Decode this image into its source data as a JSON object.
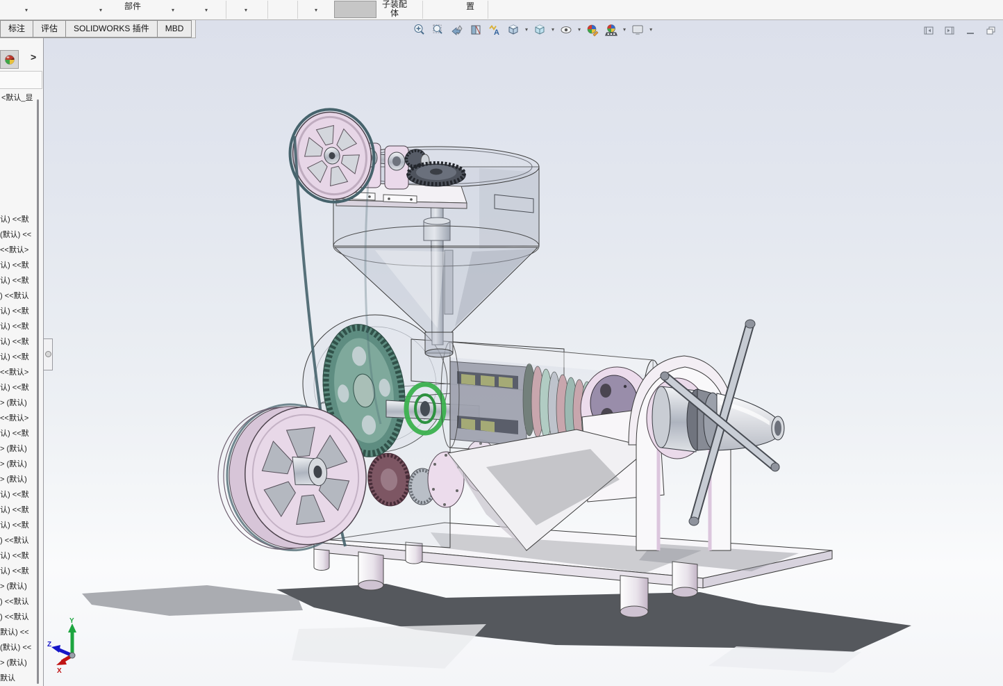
{
  "command_manager": {
    "part_label": "部件",
    "subassembly_label": "子装配体",
    "layout_label": "置",
    "dropdown_glyph": "▾",
    "tabs": [
      "标注",
      "评估",
      "SOLIDWORKS 插件",
      "MBD"
    ]
  },
  "view_toolbar": {
    "dropdown_glyph": "▾",
    "icons": [
      "zoom-to-fit",
      "zoom-to-area",
      "previous-view",
      "section-view",
      "hide-show-annotations",
      "view-orientation",
      "display-style",
      "hide-show-items",
      "edit-appearance",
      "apply-scene",
      "view-settings"
    ]
  },
  "window_controls": {
    "icons": [
      "collapse-left-pane",
      "collapse-right-pane",
      "minimize-window",
      "restore-window"
    ]
  },
  "sidebar": {
    "panel_tab_icon": "appearance-sphere-icon",
    "expand_glyph": ">",
    "config_header": "<默认_显",
    "items": [
      "认) <<默",
      "(默认) <<",
      "<<默认>",
      "认) <<默",
      "认) <<默",
      ") <<默认",
      "认) <<默",
      "认) <<默",
      "认) <<默",
      "认) <<默",
      "<<默认>",
      "认) <<默",
      "> (默认)",
      "<<默认>",
      "认) <<默",
      "> (默认)",
      "> (默认)",
      "> (默认)",
      "认) <<默",
      "认) <<默",
      "认) <<默",
      ") <<默认",
      "认) <<默",
      "认) <<默",
      "> (默认)",
      ") <<默认",
      ") <<默认",
      "默认) <<",
      "(默认) <<",
      "> (默认)",
      "默认"
    ]
  },
  "viewport": {
    "triad": {
      "x": "X",
      "y": "Y",
      "z": "Z"
    },
    "model": "screw-oil-press-assembly",
    "palette": {
      "background_top": "#dce0eb",
      "background_bottom": "#fafbfc",
      "machine_pink": "#e7d7e7",
      "gear_teal": "#5e8d81",
      "bearing_green": "#3bb14e",
      "ring_pink": "#c59ba2",
      "ring_teal": "#a9cabc",
      "belt": "#46636c",
      "floor_shadow": "#55585d",
      "white_parts": "#f8f6f9"
    }
  }
}
